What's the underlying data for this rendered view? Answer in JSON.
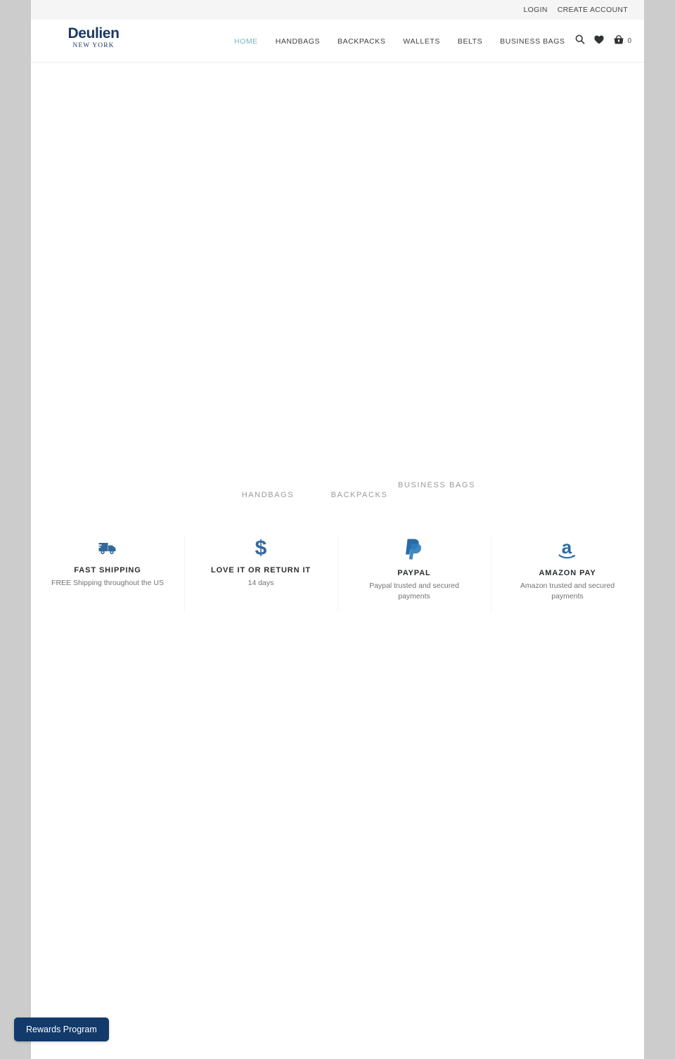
{
  "brand": {
    "name": "Deulien",
    "tagline": "NEW YORK",
    "accent_color": "#1b3964",
    "nav_active_color": "#73b8bb",
    "icon_blue": "#31699e",
    "rewards_bg": "#123a6b"
  },
  "topbar": {
    "links": [
      {
        "label": "LOGIN"
      },
      {
        "label": "CREATE ACCOUNT"
      }
    ]
  },
  "nav": {
    "items": [
      {
        "label": "HOME",
        "active": true
      },
      {
        "label": "HANDBAGS",
        "active": false
      },
      {
        "label": "BACKPACKS",
        "active": false
      },
      {
        "label": "WALLETS",
        "active": false
      },
      {
        "label": "BELTS",
        "active": false
      },
      {
        "label": "BUSINESS BAGS",
        "active": false
      }
    ]
  },
  "tools": {
    "search_icon": "search-icon",
    "wishlist_icon": "heart-icon",
    "cart_icon": "shopping-bag-icon",
    "cart_count": "0"
  },
  "categories": [
    {
      "label": "HANDBAGS"
    },
    {
      "label": "BACKPACKS"
    },
    {
      "label": "BUSINESS BAGS"
    }
  ],
  "features": [
    {
      "icon": "delivery-truck-icon",
      "title": "FAST SHIPPING",
      "desc": "FREE Shipping throughout the US"
    },
    {
      "icon": "dollar-sign-icon",
      "title": "LOVE IT OR RETURN IT",
      "desc": "14 days"
    },
    {
      "icon": "paypal-icon",
      "title": "PAYPAL",
      "desc": "Paypal trusted and secured payments"
    },
    {
      "icon": "amazon-pay-icon",
      "title": "AMAZON PAY",
      "desc": "Amazon trusted and secured payments"
    }
  ],
  "rewards": {
    "label": "Rewards Program"
  }
}
